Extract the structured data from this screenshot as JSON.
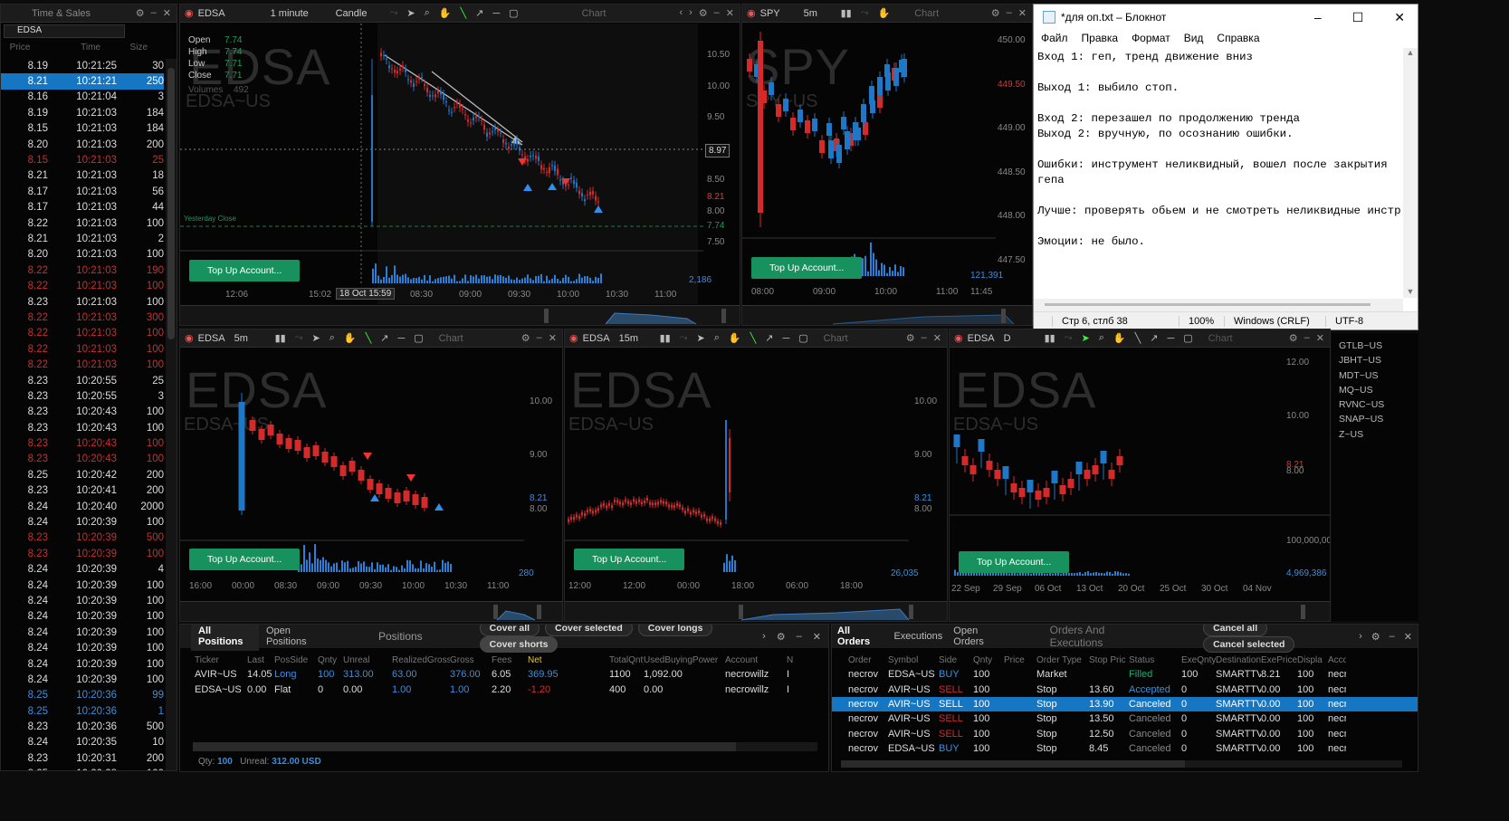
{
  "ts": {
    "title": "Time & Sales",
    "symbol": "EDSA",
    "cols": [
      "Price",
      "Time",
      "Size"
    ],
    "rows": [
      {
        "p": "8.19",
        "t": "10:21:25",
        "s": "30",
        "c": ""
      },
      {
        "p": "8.21",
        "t": "10:21:21",
        "s": "250",
        "c": "sel"
      },
      {
        "p": "8.16",
        "t": "10:21:04",
        "s": "3",
        "c": ""
      },
      {
        "p": "8.19",
        "t": "10:21:03",
        "s": "184",
        "c": ""
      },
      {
        "p": "8.15",
        "t": "10:21:03",
        "s": "184",
        "c": ""
      },
      {
        "p": "8.20",
        "t": "10:21:03",
        "s": "200",
        "c": ""
      },
      {
        "p": "8.15",
        "t": "10:21:03",
        "s": "25",
        "c": "red"
      },
      {
        "p": "8.21",
        "t": "10:21:03",
        "s": "18",
        "c": ""
      },
      {
        "p": "8.17",
        "t": "10:21:03",
        "s": "56",
        "c": ""
      },
      {
        "p": "8.17",
        "t": "10:21:03",
        "s": "44",
        "c": ""
      },
      {
        "p": "8.22",
        "t": "10:21:03",
        "s": "100",
        "c": ""
      },
      {
        "p": "8.21",
        "t": "10:21:03",
        "s": "2",
        "c": ""
      },
      {
        "p": "8.20",
        "t": "10:21:03",
        "s": "100",
        "c": ""
      },
      {
        "p": "8.22",
        "t": "10:21:03",
        "s": "190",
        "c": "red"
      },
      {
        "p": "8.22",
        "t": "10:21:03",
        "s": "100",
        "c": "red"
      },
      {
        "p": "8.23",
        "t": "10:21:03",
        "s": "100",
        "c": ""
      },
      {
        "p": "8.22",
        "t": "10:21:03",
        "s": "300",
        "c": "red"
      },
      {
        "p": "8.22",
        "t": "10:21:03",
        "s": "100",
        "c": "red"
      },
      {
        "p": "8.22",
        "t": "10:21:03",
        "s": "100",
        "c": "red"
      },
      {
        "p": "8.22",
        "t": "10:21:03",
        "s": "100",
        "c": "red"
      },
      {
        "p": "8.23",
        "t": "10:20:55",
        "s": "25",
        "c": ""
      },
      {
        "p": "8.23",
        "t": "10:20:55",
        "s": "3",
        "c": ""
      },
      {
        "p": "8.23",
        "t": "10:20:43",
        "s": "100",
        "c": ""
      },
      {
        "p": "8.23",
        "t": "10:20:43",
        "s": "100",
        "c": ""
      },
      {
        "p": "8.23",
        "t": "10:20:43",
        "s": "100",
        "c": "red"
      },
      {
        "p": "8.23",
        "t": "10:20:43",
        "s": "100",
        "c": "red"
      },
      {
        "p": "8.25",
        "t": "10:20:42",
        "s": "200",
        "c": ""
      },
      {
        "p": "8.23",
        "t": "10:20:41",
        "s": "200",
        "c": ""
      },
      {
        "p": "8.24",
        "t": "10:20:40",
        "s": "2000",
        "c": ""
      },
      {
        "p": "8.24",
        "t": "10:20:39",
        "s": "100",
        "c": ""
      },
      {
        "p": "8.23",
        "t": "10:20:39",
        "s": "500",
        "c": "red"
      },
      {
        "p": "8.23",
        "t": "10:20:39",
        "s": "100",
        "c": "red"
      },
      {
        "p": "8.24",
        "t": "10:20:39",
        "s": "4",
        "c": ""
      },
      {
        "p": "8.24",
        "t": "10:20:39",
        "s": "100",
        "c": ""
      },
      {
        "p": "8.24",
        "t": "10:20:39",
        "s": "100",
        "c": ""
      },
      {
        "p": "8.24",
        "t": "10:20:39",
        "s": "100",
        "c": ""
      },
      {
        "p": "8.24",
        "t": "10:20:39",
        "s": "100",
        "c": ""
      },
      {
        "p": "8.24",
        "t": "10:20:39",
        "s": "100",
        "c": ""
      },
      {
        "p": "8.24",
        "t": "10:20:39",
        "s": "100",
        "c": ""
      },
      {
        "p": "8.24",
        "t": "10:20:39",
        "s": "100",
        "c": ""
      },
      {
        "p": "8.25",
        "t": "10:20:36",
        "s": "99",
        "c": "blue"
      },
      {
        "p": "8.25",
        "t": "10:20:36",
        "s": "1",
        "c": "blue"
      },
      {
        "p": "8.23",
        "t": "10:20:36",
        "s": "500",
        "c": ""
      },
      {
        "p": "8.24",
        "t": "10:20:35",
        "s": "10",
        "c": ""
      },
      {
        "p": "8.23",
        "t": "10:20:31",
        "s": "200",
        "c": ""
      },
      {
        "p": "8.25",
        "t": "10:20:28",
        "s": "100",
        "c": ""
      },
      {
        "p": "8.25",
        "t": "10:20:28",
        "s": "1",
        "c": ""
      },
      {
        "p": "8.25",
        "t": "10:20:28",
        "s": "1",
        "c": ""
      }
    ]
  },
  "chart_main": {
    "symbol": "EDSA",
    "interval": "1 minute",
    "type": "Candle",
    "label": "Chart",
    "wm": "EDSA",
    "wm2": "EDSA~US",
    "ohlc_labels": [
      "Open",
      "High",
      "Low",
      "Close"
    ],
    "ohlc_values": [
      "7.74",
      "7.74",
      "7.71",
      "7.71"
    ],
    "volumes_label": "Volumes",
    "volumes_value": "492",
    "yesterday": "Yesterday Close",
    "y_ticks": [
      "10.50",
      "10.00",
      "9.50",
      "9.00",
      "8.50",
      "8.00",
      "7.50"
    ],
    "price_marker": "8.97",
    "red_price": "8.21",
    "close_price": "7.74",
    "vol_label": "2,186",
    "x_ticks": [
      "12:06",
      "15:02",
      "18 Oct 15:59",
      "08:30",
      "09:00",
      "09:30",
      "10:00",
      "10:30",
      "11:00"
    ],
    "topup": "Top Up Account..."
  },
  "chart_spy": {
    "symbol": "SPY",
    "interval": "5m",
    "label": "Chart",
    "wm": "SPY",
    "wm2": "SPY~US",
    "y_ticks": [
      "450.00",
      "449.50",
      "449.00",
      "448.50",
      "448.00",
      "447.50"
    ],
    "vol_label": "121,391",
    "x_ticks": [
      "08:00",
      "09:00",
      "10:00",
      "11:00",
      "11:45"
    ],
    "topup": "Top Up Account..."
  },
  "chart_b1": {
    "symbol": "EDSA",
    "interval": "5m",
    "label": "Chart",
    "wm": "EDSA",
    "wm2": "EDSA~US",
    "y_ticks": [
      "10.00",
      "9.00",
      "8.21",
      "8.00"
    ],
    "vol_label": "280",
    "x_ticks": [
      "16:00",
      "00:00",
      "08:30",
      "09:00",
      "09:30",
      "10:00",
      "10:30",
      "11:00"
    ],
    "topup": "Top Up Account..."
  },
  "chart_b2": {
    "symbol": "EDSA",
    "interval": "15m",
    "label": "Chart",
    "wm": "EDSA",
    "wm2": "EDSA~US",
    "y_ticks": [
      "10.00",
      "9.00",
      "8.21",
      "8.00"
    ],
    "vol_label": "26,035",
    "x_ticks": [
      "12:00",
      "12:00",
      "00:00",
      "18:00",
      "06:00",
      "18:00"
    ],
    "topup": "Top Up Account..."
  },
  "chart_b3": {
    "symbol": "EDSA",
    "interval": "D",
    "label": "Chart",
    "wm": "EDSA",
    "wm2": "EDSA~US",
    "y_ticks": [
      "12.00",
      "10.00",
      "8.21",
      "8.00",
      "100,000,000"
    ],
    "vol_label": "4,969,386",
    "x_ticks": [
      "22 Sep",
      "29 Sep",
      "06 Oct",
      "13 Oct",
      "20 Oct",
      "25 Oct",
      "30 Oct",
      "04 Nov"
    ],
    "topup": "Top Up Account..."
  },
  "watchlist": [
    "GTLB~US",
    "JBHT~US",
    "MDT~US",
    "MQ~US",
    "RVNC~US",
    "SNAP~US",
    "Z~US"
  ],
  "positions": {
    "tabs": [
      "All Positions",
      "Open Positions"
    ],
    "title": "Positions",
    "buttons": [
      "Cover all",
      "Cover selected",
      "Cover longs",
      "Cover shorts"
    ],
    "headers": [
      "Ticker",
      "Last",
      "PosSide",
      "Qnty",
      "Unreal",
      "RealizedGross",
      "Gross",
      "Fees",
      "Net",
      "TotalQnty",
      "UsedBuyingPower",
      "Account",
      "N"
    ],
    "rows": [
      [
        "AVIR~US",
        "14.05",
        "Long",
        "100",
        "313.00",
        "63.00",
        "376.00",
        "6.05",
        "369.95",
        "1100",
        "1,092.00",
        "necrowillz",
        "I"
      ],
      [
        "EDSA~US",
        "0.00",
        "Flat",
        "0",
        "0.00",
        "1.00",
        "1.00",
        "2.20",
        "-1.20",
        "400",
        "0.00",
        "necrowillz",
        "I"
      ]
    ],
    "footer_qty_label": "Qty:",
    "footer_qty": "100",
    "footer_unreal_label": "Unreal:",
    "footer_unreal": "312.00 USD"
  },
  "orders": {
    "tabs": [
      "All Orders",
      "Executions",
      "Open Orders"
    ],
    "title": "Orders And Executions",
    "buttons": [
      "Cancel all",
      "Cancel selected"
    ],
    "headers": [
      "Order",
      "Symbol",
      "Side",
      "Qnty",
      "Price",
      "Order Type",
      "Stop Pric",
      "Status",
      "ExeQnty",
      "Destination",
      "ExePrice",
      "Displa",
      "Accou"
    ],
    "rows": [
      [
        "necrov",
        "EDSA~US",
        "BUY",
        "100",
        "",
        "Market",
        "",
        "Filled",
        "100",
        "SMARTTV",
        "8.21",
        "100",
        "necr"
      ],
      [
        "necrov",
        "AVIR~US",
        "SELL",
        "100",
        "",
        "Stop",
        "13.60",
        "Accepted",
        "0",
        "SMARTTV",
        "0.00",
        "100",
        "necr"
      ],
      [
        "necrov",
        "AVIR~US",
        "SELL",
        "100",
        "",
        "Stop",
        "13.90",
        "Canceled",
        "0",
        "SMARTTV",
        "0.00",
        "100",
        "necr"
      ],
      [
        "necrov",
        "AVIR~US",
        "SELL",
        "100",
        "",
        "Stop",
        "13.50",
        "Canceled",
        "0",
        "SMARTTV",
        "0.00",
        "100",
        "necr"
      ],
      [
        "necrov",
        "AVIR~US",
        "SELL",
        "100",
        "",
        "Stop",
        "12.50",
        "Canceled",
        "0",
        "SMARTTV",
        "0.00",
        "100",
        "necr"
      ],
      [
        "necrov",
        "EDSA~US",
        "BUY",
        "100",
        "",
        "Stop",
        "8.45",
        "Canceled",
        "0",
        "SMARTTV",
        "0.00",
        "100",
        "necr"
      ]
    ]
  },
  "notepad": {
    "title": "*для оп.txt – Блокнот",
    "menu": [
      "Файл",
      "Правка",
      "Формат",
      "Вид",
      "Справка"
    ],
    "text": "Вход 1: геп, тренд движение вниз\n\nВыход 1: выбило стоп.\n\nВход 2: перезашел по продолжению тренда\nВыход 2: вручную, по осознанию ошибки.\n\nОшибки: инструмент неликвидный, вошел после закрытия\nгепа\n\nЛучше: проверять обьем и не смотреть неликвидные инстр\n\nЭмоции: не было.",
    "status": [
      "Стр 6, стлб 38",
      "100%",
      "Windows (CRLF)",
      "UTF-8"
    ]
  },
  "colors": {
    "green": "#17925f",
    "red": "#d12b2b",
    "blue": "#3a8fe0",
    "select": "#1576c4"
  }
}
